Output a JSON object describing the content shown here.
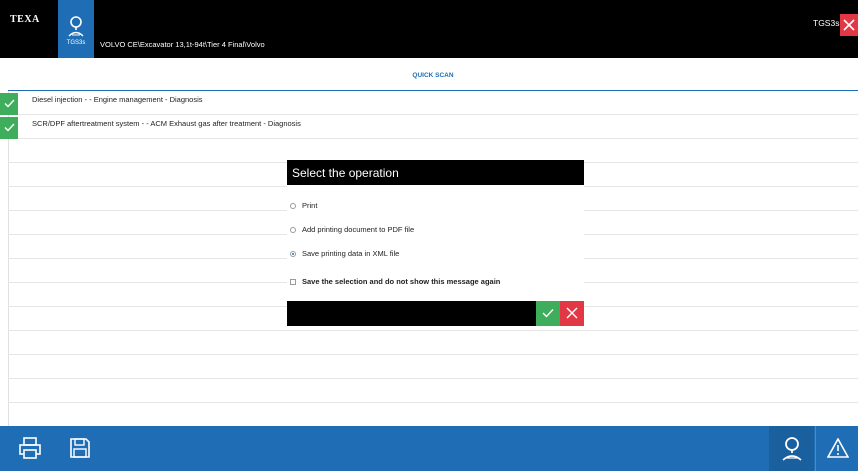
{
  "header": {
    "brand": "TEXA",
    "tgs_label": "TGS3s",
    "vehicle_path": "VOLVO CE\\Excavator 13,1t-94t\\Tier 4 Final\\Volvo",
    "device_name": "TGS3s",
    "close_icon": "close-icon"
  },
  "tabbar": {
    "label": "QUICK SCAN"
  },
  "results": [
    {
      "text": "Diesel injection - - Engine management - Diagnosis",
      "status": "ok"
    },
    {
      "text": "SCR/DPF aftertreatment system - - ACM Exhaust gas after treatment - Diagnosis",
      "status": "ok"
    }
  ],
  "dialog": {
    "title": "Select the operation",
    "options": [
      {
        "label": "Print",
        "selected": false
      },
      {
        "label": "Add printing document to PDF file",
        "selected": false
      },
      {
        "label": "Save printing data in XML file",
        "selected": true
      }
    ],
    "remember_label": "Save the selection and do not show this message again",
    "remember_checked": false
  },
  "bottombar": {
    "icons": [
      "printer-icon",
      "floppy-disk-icon",
      "person-search-icon",
      "warning-icon"
    ]
  },
  "colors": {
    "accent": "#1f6db5",
    "ok": "#3fae5c",
    "cancel": "#e23744",
    "header_bg": "#000000"
  }
}
